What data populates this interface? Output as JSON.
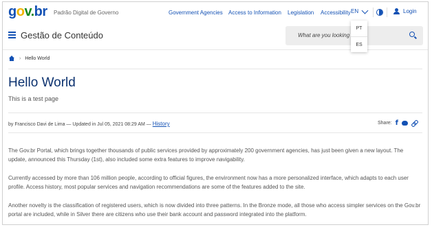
{
  "header": {
    "logo": {
      "g": "g",
      "o": "o",
      "v": "v.",
      "b": "br"
    },
    "tagline": "Padrão Digital de Governo",
    "links": [
      "Government Agencies",
      "Access to Information",
      "Legislation",
      "Accessibility"
    ],
    "language": "EN",
    "login_label": "Login",
    "accent_color": "#1351b4"
  },
  "appbar": {
    "title": "Gestão de Conteúdo",
    "search_placeholder": "What are you looking"
  },
  "language_menu": {
    "options": [
      "PT",
      "ES"
    ]
  },
  "breadcrumb": {
    "current": "Hello World"
  },
  "page": {
    "title": "Hello World",
    "subtitle": "This is a test page"
  },
  "byline": {
    "text": "by Francisco Davi de Lima — Updated in Jul 05, 2021 08:29 AM —",
    "history_link": "History"
  },
  "share": {
    "label": "Share:",
    "icons": [
      "facebook-icon",
      "twitter-icon",
      "link-icon"
    ]
  },
  "paragraphs": [
    "The Gov.br Portal, which brings together thousands of public services provided by approximately 200 government agencies, has just been given a new layout. The update, announced this Thursday (1st), also included some extra features to improve navigability.",
    "Currently accessed by more than 106 million people, according to official figures, the environment now has a more personalized interface, which adapts to each user profile. Access history, most popular services and navigation recommendations are some of the features added to the site.",
    "Another novelty is the classification of registered users, which is now divided into three patterns. In the Bronze mode, all those who access simpler services on the Gov.br portal are included, while in Silver there are citizens who use their bank account and password integrated into the platform."
  ]
}
